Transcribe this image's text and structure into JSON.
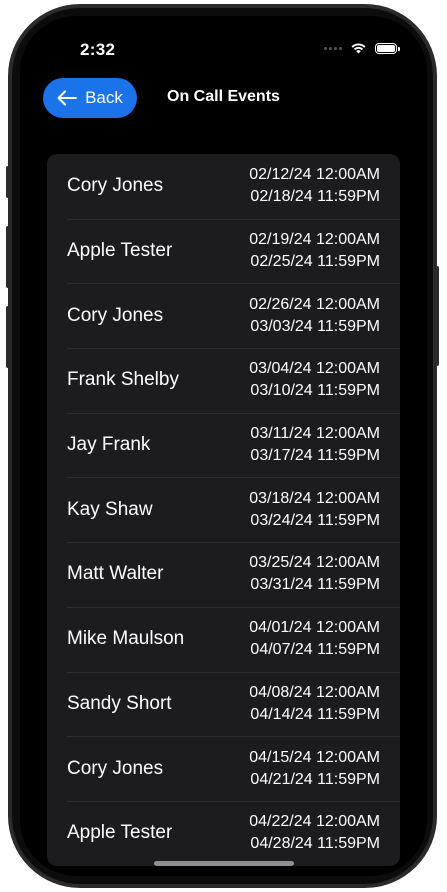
{
  "status_bar": {
    "time": "2:32"
  },
  "nav": {
    "back_label": "Back",
    "title": "On Call Events"
  },
  "colors": {
    "accent": "#1a73e8",
    "background": "#000000",
    "card": "#1c1c1e"
  },
  "events": [
    {
      "name": "Cory Jones",
      "start": "02/12/24 12:00AM",
      "end": "02/18/24 11:59PM"
    },
    {
      "name": "Apple Tester",
      "start": "02/19/24 12:00AM",
      "end": "02/25/24 11:59PM"
    },
    {
      "name": "Cory Jones",
      "start": "02/26/24 12:00AM",
      "end": "03/03/24 11:59PM"
    },
    {
      "name": "Frank Shelby",
      "start": "03/04/24 12:00AM",
      "end": "03/10/24 11:59PM"
    },
    {
      "name": "Jay Frank",
      "start": "03/11/24 12:00AM",
      "end": "03/17/24 11:59PM"
    },
    {
      "name": "Kay Shaw",
      "start": "03/18/24 12:00AM",
      "end": "03/24/24 11:59PM"
    },
    {
      "name": "Matt Walter",
      "start": "03/25/24 12:00AM",
      "end": "03/31/24 11:59PM"
    },
    {
      "name": "Mike Maulson",
      "start": "04/01/24 12:00AM",
      "end": "04/07/24 11:59PM"
    },
    {
      "name": "Sandy Short",
      "start": "04/08/24 12:00AM",
      "end": "04/14/24 11:59PM"
    },
    {
      "name": "Cory Jones",
      "start": "04/15/24 12:00AM",
      "end": "04/21/24 11:59PM"
    },
    {
      "name": "Apple Tester",
      "start": "04/22/24 12:00AM",
      "end": "04/28/24 11:59PM"
    }
  ]
}
